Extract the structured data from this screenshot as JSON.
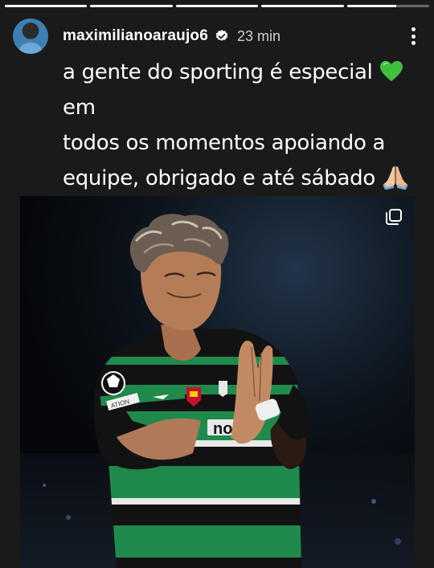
{
  "story": {
    "segments": [
      1,
      1,
      1,
      1,
      0.6
    ],
    "username": "maximilianoaraujo6",
    "timestamp": "23 min",
    "caption_lines": [
      "a gente do sporting é especial",
      "todos os momentos apoiando a",
      "equipe, obrigado e até sábado"
    ],
    "caption_line1_end": "em"
  },
  "photo": {
    "jersey_sponsor_fragment": "no",
    "badge_text": "ATION"
  },
  "icons": {
    "verified": "verified-badge-icon",
    "menu": "more-options-icon",
    "multi": "multiple-photos-icon",
    "heart": "green-heart-emoji",
    "hands": "folded-hands-emoji"
  },
  "colors": {
    "background": "#1a1a1a",
    "verified": "#ffffff",
    "green_heart": "#3fbf3f",
    "jersey_green": "#1f8a4c"
  }
}
